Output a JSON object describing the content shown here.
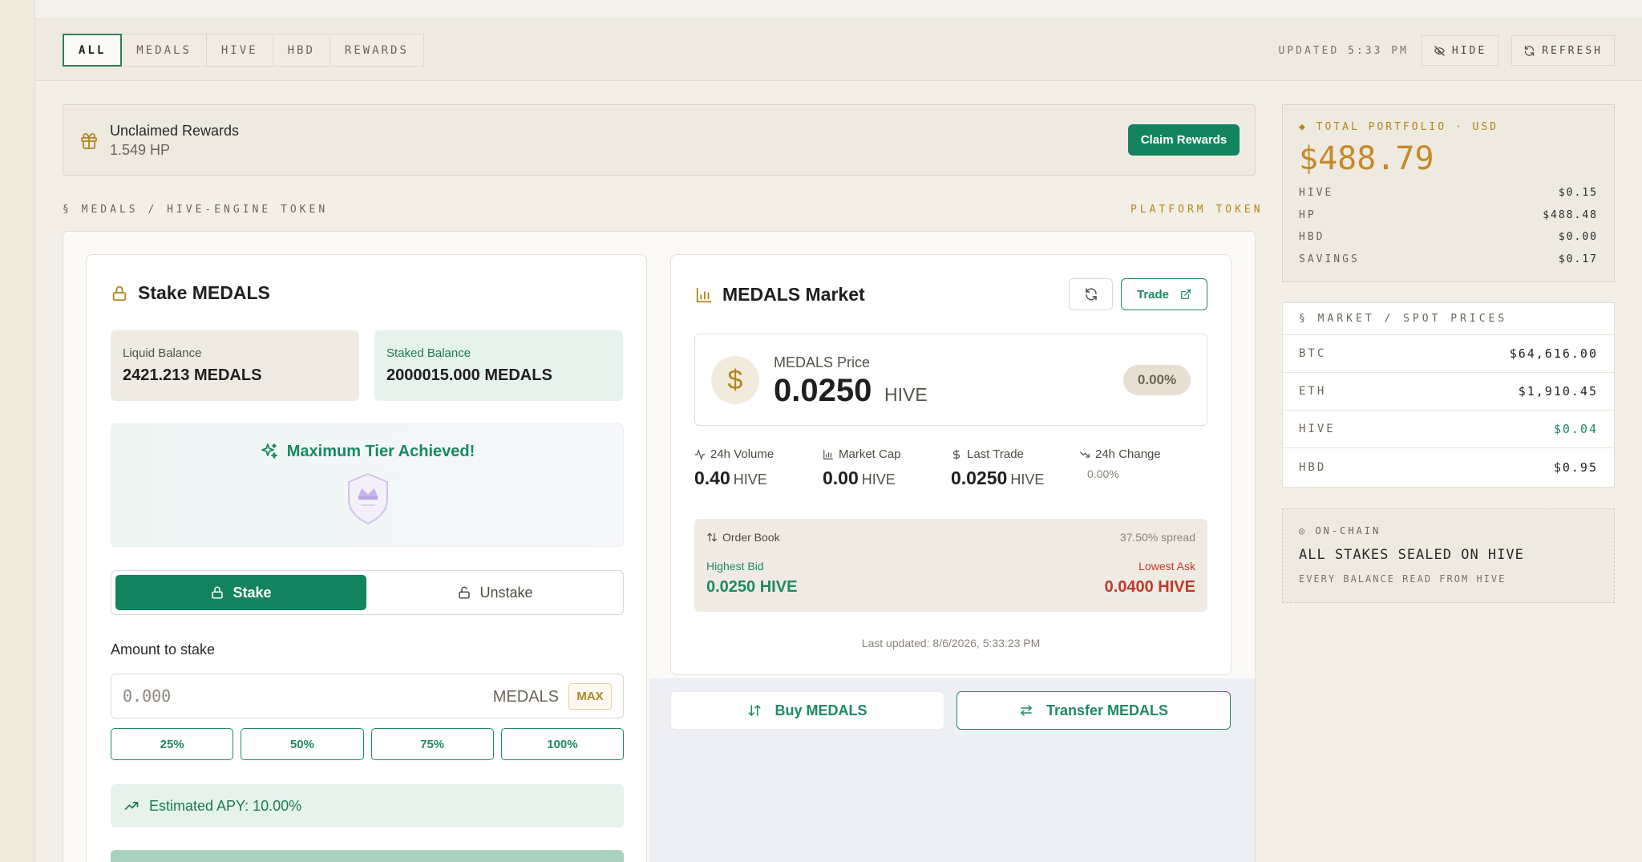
{
  "tabs": [
    {
      "label": "ALL",
      "active": true
    },
    {
      "label": "MEDALS",
      "active": false
    },
    {
      "label": "HIVE",
      "active": false
    },
    {
      "label": "HBD",
      "active": false
    },
    {
      "label": "REWARDS",
      "active": false
    }
  ],
  "toolbar": {
    "updated": "UPDATED 5:33 PM",
    "hide_label": "HIDE",
    "refresh_label": "REFRESH"
  },
  "rewards": {
    "title": "Unclaimed Rewards",
    "amount": "1.549 HP",
    "claim_label": "Claim Rewards"
  },
  "section": {
    "label": "§ MEDALS / HIVE-ENGINE TOKEN",
    "platform_token": "PLATFORM TOKEN"
  },
  "stake": {
    "title": "Stake MEDALS",
    "liquid_label": "Liquid Balance",
    "liquid_value": "2421.213 MEDALS",
    "staked_label": "Staked Balance",
    "staked_value": "2000015.000 MEDALS",
    "tier_text": "Maximum Tier Achieved!",
    "stake_tab": "Stake",
    "unstake_tab": "Unstake",
    "amount_label": "Amount to stake",
    "amount_placeholder": "0.000",
    "amount_unit": "MEDALS",
    "max_label": "MAX",
    "percents": [
      "25%",
      "50%",
      "75%",
      "100%"
    ],
    "apy_text": "Estimated APY: 10.00%"
  },
  "market": {
    "title": "MEDALS Market",
    "trade_label": "Trade",
    "price_label": "MEDALS Price",
    "price_value": "0.0250",
    "price_unit": "HIVE",
    "price_change": "0.00%",
    "stats": [
      {
        "label": "24h Volume",
        "value": "0.40",
        "unit": "HIVE",
        "icon": "activity-icon"
      },
      {
        "label": "Market Cap",
        "value": "0.00",
        "unit": "HIVE",
        "icon": "bar-chart-icon"
      },
      {
        "label": "Last Trade",
        "value": "0.0250",
        "unit": "HIVE",
        "icon": "dollar-icon"
      },
      {
        "label": "24h Change",
        "sub": "0.00%",
        "icon": "trending-down-icon"
      }
    ],
    "orderbook": {
      "title": "Order Book",
      "spread": "37.50% spread",
      "bid_label": "Highest Bid",
      "bid_value": "0.0250 HIVE",
      "ask_label": "Lowest Ask",
      "ask_value": "0.0400 HIVE"
    },
    "last_updated": "Last updated: 8/6/2026, 5:33:23 PM"
  },
  "actions": {
    "buy_label": "Buy MEDALS",
    "transfer_label": "Transfer MEDALS"
  },
  "portfolio": {
    "label": "◆ TOTAL PORTFOLIO · USD",
    "total": "$488.79",
    "rows": [
      {
        "name": "HIVE",
        "value": "$0.15"
      },
      {
        "name": "HP",
        "value": "$488.48"
      },
      {
        "name": "HBD",
        "value": "$0.00"
      },
      {
        "name": "SAVINGS",
        "value": "$0.17"
      }
    ]
  },
  "spot": {
    "title": "§ MARKET / SPOT PRICES",
    "rows": [
      {
        "name": "BTC",
        "value": "$64,616.00"
      },
      {
        "name": "ETH",
        "value": "$1,910.45"
      },
      {
        "name": "HIVE",
        "value": "$0.04"
      },
      {
        "name": "HBD",
        "value": "$0.95"
      }
    ]
  },
  "onchain": {
    "label": "◎ ON-CHAIN",
    "title": "ALL STAKES SEALED ON HIVE",
    "sub": "EVERY BALANCE READ FROM HIVE"
  },
  "colors": {
    "accent_green": "#13845f",
    "gold": "#b6841f",
    "ask_red": "#c0392b"
  }
}
